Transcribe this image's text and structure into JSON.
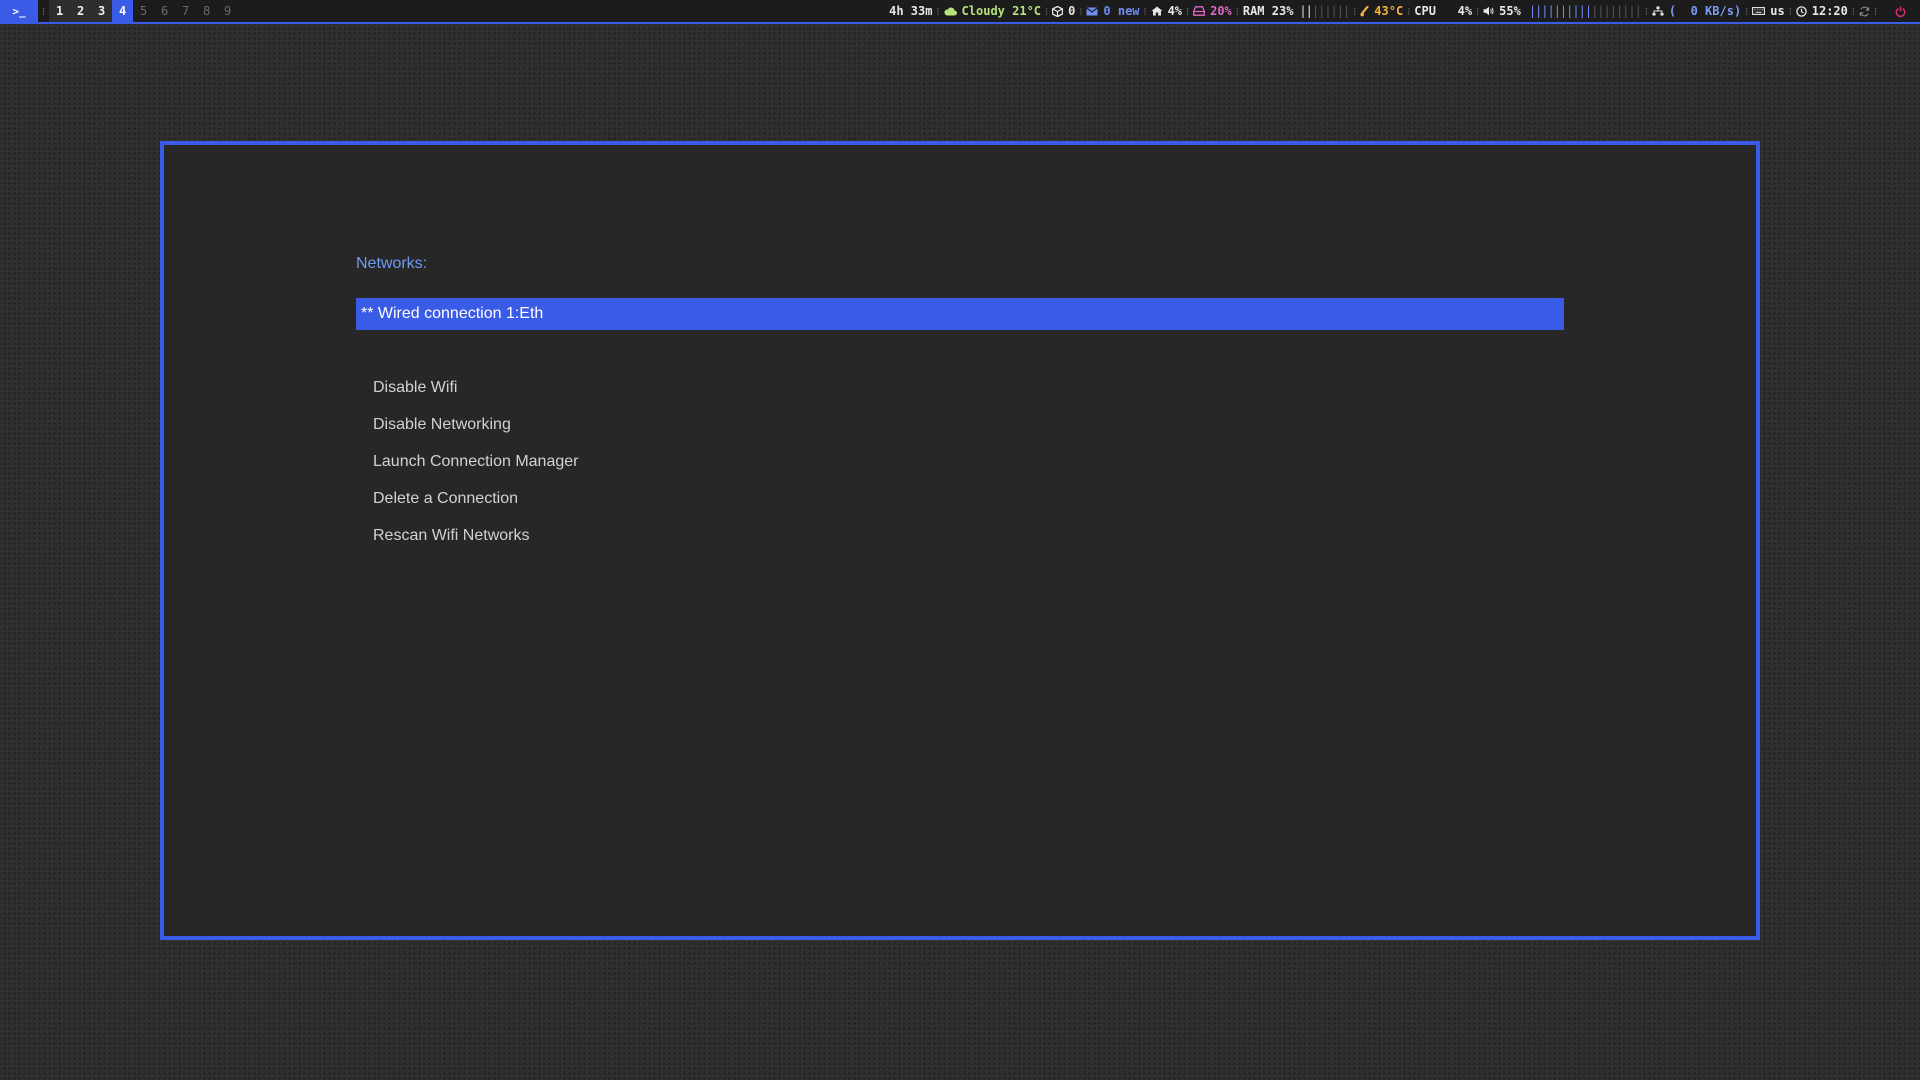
{
  "topbar": {
    "terminal_glyph": ">_",
    "workspaces": [
      {
        "label": "1",
        "state": "occupied"
      },
      {
        "label": "2",
        "state": "occupied"
      },
      {
        "label": "3",
        "state": "occupied"
      },
      {
        "label": "4",
        "state": "active"
      },
      {
        "label": "5",
        "state": "empty"
      },
      {
        "label": "6",
        "state": "empty"
      },
      {
        "label": "7",
        "state": "empty"
      },
      {
        "label": "8",
        "state": "empty"
      },
      {
        "label": "9",
        "state": "empty"
      }
    ],
    "uptime": "4h 33m",
    "weather": "Cloudy 21°C",
    "packages": "0",
    "mail": "0 new",
    "home_disk": "4%",
    "disk": "20%",
    "ram": "RAM 23%",
    "ram_bar": "||||||||",
    "temperature": "43°C",
    "cpu": "CPU   4%",
    "volume": "55%",
    "volume_bar": "||||||||||||||||||",
    "network": "(  0 KB/s)",
    "keyboard_layout": "us",
    "clock": "12:20",
    "colors": {
      "accent": "#3a5be6",
      "weather": "#b6e37a",
      "mail": "#6f8cf5",
      "disk": "#e066c7",
      "temperature": "#f2b33d",
      "network": "#7d9cf5",
      "power": "#e0307a"
    }
  },
  "dialog": {
    "prompt": "Networks:",
    "selected": "** Wired connection 1:Eth",
    "options": [
      "Disable Wifi",
      "Disable Networking",
      "Launch Connection Manager",
      "Delete a Connection",
      "Rescan Wifi Networks"
    ]
  }
}
